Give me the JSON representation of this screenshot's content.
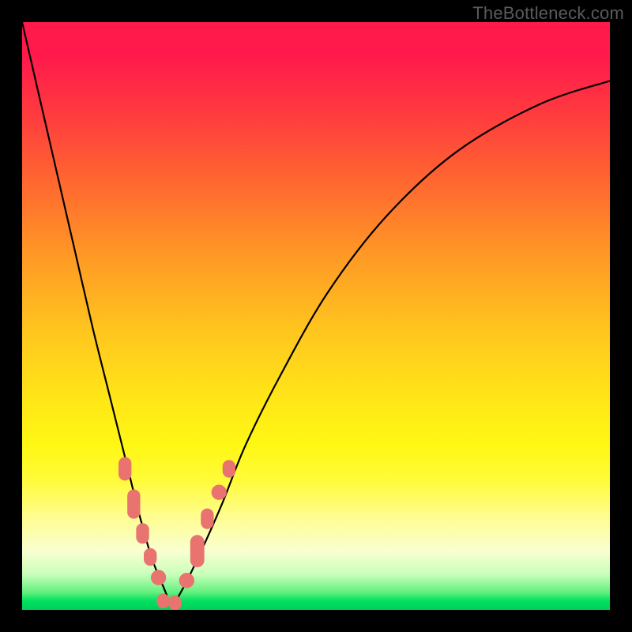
{
  "watermark": "TheBottleneck.com",
  "colors": {
    "bead": "#e9736f",
    "curve": "#000000",
    "frame": "#000000"
  },
  "chart_data": {
    "type": "line",
    "title": "",
    "xlabel": "",
    "ylabel": "",
    "xlim": [
      0,
      100
    ],
    "ylim": [
      0,
      100
    ],
    "grid": false,
    "legend": false,
    "annotations": [
      "TheBottleneck.com"
    ],
    "series": [
      {
        "name": "bottleneck-curve",
        "x": [
          0,
          3,
          6,
          9,
          12,
          15,
          18,
          20,
          22,
          24,
          25.5,
          27,
          30,
          34,
          38,
          44,
          52,
          62,
          74,
          88,
          100
        ],
        "y": [
          100,
          87,
          74,
          61,
          48,
          36,
          24,
          16,
          9,
          4,
          1,
          3,
          9,
          18,
          28,
          40,
          54,
          67,
          78,
          86,
          90
        ]
      }
    ],
    "markers": [
      {
        "name": "bead",
        "shape": "rounded-rect",
        "x": 17.5,
        "y": 24,
        "w": 2.2,
        "h": 4.0
      },
      {
        "name": "bead",
        "shape": "rounded-rect",
        "x": 19.0,
        "y": 18,
        "w": 2.2,
        "h": 5.0
      },
      {
        "name": "bead",
        "shape": "rounded-rect",
        "x": 20.5,
        "y": 13,
        "w": 2.2,
        "h": 3.5
      },
      {
        "name": "bead",
        "shape": "rounded-rect",
        "x": 21.8,
        "y": 9,
        "w": 2.2,
        "h": 3.0
      },
      {
        "name": "bead",
        "shape": "circle",
        "x": 23.2,
        "y": 5.5,
        "r": 1.3
      },
      {
        "name": "bead",
        "shape": "rounded-rect",
        "x": 24.0,
        "y": 1.5,
        "w": 2.2,
        "h": 2.5
      },
      {
        "name": "bead",
        "shape": "rounded-rect",
        "x": 26.0,
        "y": 1.2,
        "w": 2.2,
        "h": 2.5
      },
      {
        "name": "bead",
        "shape": "circle",
        "x": 28.0,
        "y": 5.0,
        "r": 1.3
      },
      {
        "name": "bead",
        "shape": "rounded-rect",
        "x": 29.8,
        "y": 10.0,
        "w": 2.4,
        "h": 5.5
      },
      {
        "name": "bead",
        "shape": "rounded-rect",
        "x": 31.5,
        "y": 15.5,
        "w": 2.2,
        "h": 3.5
      },
      {
        "name": "bead",
        "shape": "circle",
        "x": 33.5,
        "y": 20.0,
        "r": 1.3
      },
      {
        "name": "bead",
        "shape": "rounded-rect",
        "x": 35.2,
        "y": 24.0,
        "w": 2.2,
        "h": 3.0
      }
    ],
    "gradient_stops": [
      {
        "pct": 0,
        "color": "#ff1a4b"
      },
      {
        "pct": 40,
        "color": "#ff9a25"
      },
      {
        "pct": 72,
        "color": "#fff714"
      },
      {
        "pct": 97,
        "color": "#63f07e"
      },
      {
        "pct": 100,
        "color": "#00d058"
      }
    ],
    "minimum_at_x": 25.5
  }
}
